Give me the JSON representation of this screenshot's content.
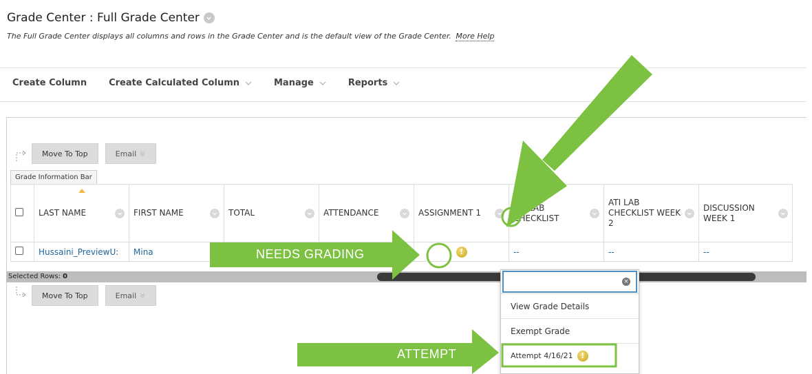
{
  "header": {
    "title": "Grade Center : Full Grade Center",
    "subtitle": "The Full Grade Center displays all columns and rows in the Grade Center and is the default view of the Grade Center.",
    "help_link": "More Help"
  },
  "action_bar": {
    "create_column": "Create Column",
    "create_calculated_column": "Create Calculated Column",
    "manage": "Manage",
    "reports": "Reports"
  },
  "toolbar": {
    "move_to_top": "Move To Top",
    "email": "Email"
  },
  "grade_info_bar": "Grade Information Bar",
  "table": {
    "columns": [
      "LAST NAME",
      "FIRST NAME",
      "TOTAL",
      "ATTENDANCE",
      "ASSIGNMENT 1",
      "ATI LAB CHECKLIST",
      "ATI LAB CHECKLIST WEEK 2",
      "DISCUSSION WEEK 1"
    ],
    "rows": [
      {
        "last_name": "Hussaini_PreviewU:",
        "first_name": "Mina",
        "total": "",
        "attendance": "",
        "assignment_1": "!",
        "ati_lab_checklist": "--",
        "ati_lab_checklist_week_2": "--",
        "discussion_week_1": "--"
      }
    ]
  },
  "selected_rows": {
    "label": "Selected Rows:",
    "count": "0"
  },
  "context_menu": {
    "search_value": "",
    "items": [
      "View Grade Details",
      "Exempt Grade",
      "Attempt 4/16/21"
    ]
  },
  "callouts": {
    "needs_grading": "NEEDS GRADING",
    "attempt": "ATTEMPT"
  },
  "colors": {
    "annotation_green": "#7dc142",
    "link_blue": "#226699",
    "needs_grading_yellow": "#d9b92c",
    "focus_blue": "#4a90c8"
  },
  "icons": {
    "needs_grading": "exclamation-circle-icon",
    "column_menu": "chevron-down-icon",
    "clear": "clear-x-icon"
  }
}
